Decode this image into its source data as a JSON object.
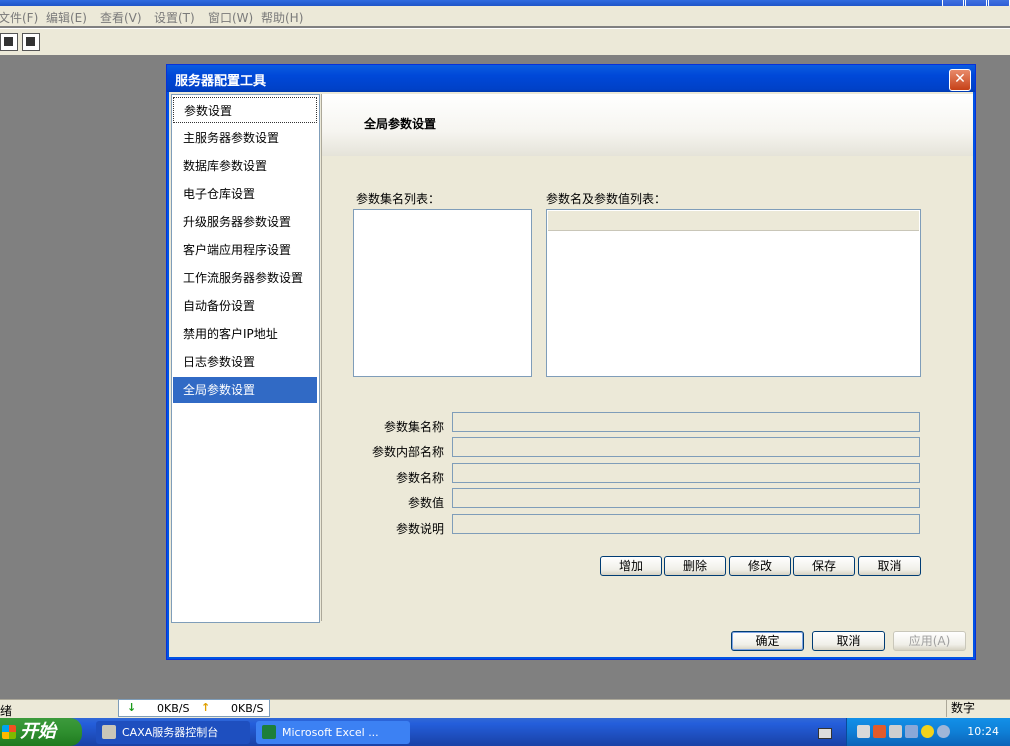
{
  "app": {
    "menu": [
      "文件(F)",
      "编辑(E)",
      "查看(V)",
      "设置(T)",
      "窗口(W)",
      "帮助(H)"
    ],
    "toolbar_icons": [
      "network-icon",
      "edit-icon"
    ]
  },
  "dialog": {
    "title": "服务器配置工具",
    "close_icon": "✕",
    "nav": [
      "参数设置",
      "主服务器参数设置",
      "数据库参数设置",
      "电子仓库设置",
      "升级服务器参数设置",
      "客户端应用程序设置",
      "工作流服务器参数设置",
      "自动备份设置",
      "禁用的客户IP地址",
      "日志参数设置",
      "全局参数设置"
    ],
    "selected_nav_index": 10,
    "content_title": "全局参数设置",
    "paramset_list_label": "参数集名列表：",
    "param_list_label": "参数名及参数值列表：",
    "fields": [
      {
        "label": "参数集名称",
        "value": ""
      },
      {
        "label": "参数内部名称",
        "value": ""
      },
      {
        "label": "参数名称",
        "value": ""
      },
      {
        "label": "参数值",
        "value": ""
      },
      {
        "label": "参数说明",
        "value": ""
      }
    ],
    "action_buttons": [
      "增加",
      "删除",
      "修改",
      "保存",
      "取消"
    ],
    "footer_buttons": {
      "ok": "确定",
      "cancel": "取消",
      "apply": "应用(A)"
    }
  },
  "statusbar": {
    "left": "绪",
    "down_speed": "0KB/S",
    "up_speed": "0KB/S",
    "right": "数字"
  },
  "taskbar": {
    "start": "开始",
    "tasks": [
      "CAXA服务器控制台",
      "Microsoft Excel ..."
    ],
    "clock": "10:24"
  },
  "colors": {
    "selection": "#316ac5",
    "titlebar": "#0054e3",
    "taskbar": "#245edb",
    "start": "#2f8f2f"
  }
}
